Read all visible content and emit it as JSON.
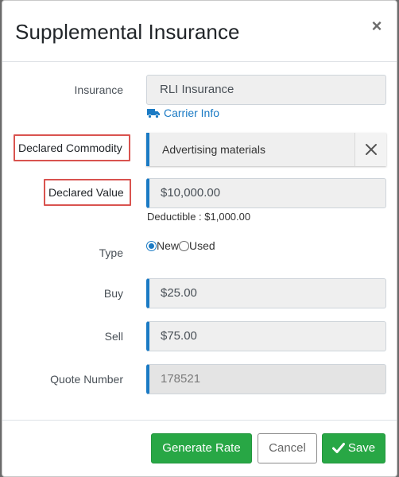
{
  "dialog": {
    "title": "Supplemental Insurance",
    "close_glyph": "×"
  },
  "fields": {
    "insurance": {
      "label": "Insurance",
      "value": "RLI Insurance"
    },
    "carrier_info": {
      "label": "Carrier Info",
      "icon": "truck-icon"
    },
    "commodity": {
      "label": "Declared Commodity",
      "value": "Advertising materials",
      "clear_icon": "close-icon"
    },
    "declared_value": {
      "label": "Declared Value",
      "value": "$10,000.00",
      "note": "Deductible : $1,000.00"
    },
    "type": {
      "label": "Type",
      "options": [
        "New",
        "Used"
      ],
      "selected": "New"
    },
    "buy": {
      "label": "Buy",
      "value": "$25.00"
    },
    "sell": {
      "label": "Sell",
      "value": "$75.00"
    },
    "quote_number": {
      "label": "Quote Number",
      "value": "178521"
    }
  },
  "footer": {
    "generate_label": "Generate Rate",
    "cancel_label": "Cancel",
    "save_label": "Save",
    "save_icon": "check-icon"
  },
  "colors": {
    "accent": "#1a7ac4",
    "success": "#28a745",
    "highlight": "#d9534f"
  }
}
